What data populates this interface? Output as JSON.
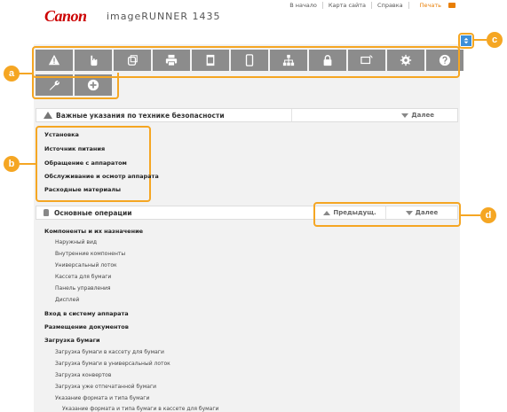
{
  "header": {
    "brand": "Canon",
    "product": "imageRUNNER 1435",
    "links": [
      "В начало",
      "Карта сайта",
      "Справка"
    ],
    "print_label": "Печать"
  },
  "nav": {
    "row1_icons": [
      "warning-icon",
      "hand-icon",
      "copy-icon",
      "print-icon",
      "scan-icon",
      "mobile-icon",
      "network-icon",
      "lock-icon",
      "remote-ui-icon",
      "settings-icon",
      "help-icon"
    ],
    "row2_icons": [
      "wrench-icon",
      "plus-icon"
    ]
  },
  "callouts": {
    "a": "a",
    "b": "b",
    "c": "c",
    "d": "d"
  },
  "safety": {
    "title": "Важные указания по технике безопасности",
    "next": "Далее",
    "items": [
      "Установка",
      "Источник питания",
      "Обращение с аппаратом",
      "Обслуживание и осмотр аппарата",
      "Расходные материалы"
    ]
  },
  "basic": {
    "title": "Основные операции",
    "prev": "Предыдущ.",
    "next": "Далее",
    "groups": [
      {
        "label": "Компоненты и их назначение",
        "subs": [
          "Наружный вид",
          "Внутренние компоненты",
          "Универсальный лоток",
          "Кассета для бумаги",
          "Панель управления",
          "Дисплей"
        ]
      },
      {
        "label": "Вход в систему аппарата",
        "subs": []
      },
      {
        "label": "Размещение документов",
        "subs": []
      },
      {
        "label": "Загрузка бумаги",
        "subs": [
          "Загрузка бумаги в кассету для бумаги",
          "Загрузка бумаги в универсальный лоток",
          "Загрузка конвертов",
          "Загрузка уже отпечатанной бумаги",
          "Указание формата и типа бумаги"
        ]
      }
    ],
    "deep": "Указание формата и типа бумаги в кассете для бумаги"
  }
}
